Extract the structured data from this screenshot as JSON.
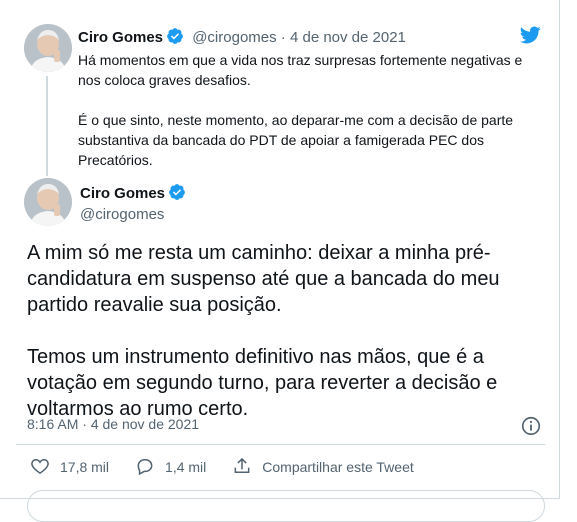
{
  "reply_tweet": {
    "author_name": "Ciro Gomes",
    "handle": "@cirogomes",
    "separator": "·",
    "date": "4 de nov de 2021",
    "paragraphs": [
      "Há momentos em que a vida nos traz surpresas fortemente negativas e nos coloca graves desafios.",
      "É o que sinto, neste momento, ao deparar-me com a decisão de parte substantiva da bancada do PDT de apoiar a famigerada PEC dos Precatórios."
    ]
  },
  "main_tweet": {
    "author_name": "Ciro Gomes",
    "handle": "@cirogomes",
    "paragraphs": [
      "A mim só me resta um caminho: deixar a minha pré-candidatura em suspenso até que a bancada do meu partido reavalie sua posição.",
      "Temos um instrumento definitivo nas mãos, que é a votação em segundo turno, para  reverter a decisão e voltarmos ao rumo certo."
    ],
    "time": "8:16 AM",
    "separator": "·",
    "date": "4 de nov de 2021"
  },
  "actions": {
    "likes": "17,8 mil",
    "replies": "1,4 mil",
    "share_label": "Compartilhar este Tweet"
  },
  "colors": {
    "twitter_blue": "#1d9bf0",
    "text": "#0f1419",
    "muted": "#536471",
    "border": "#cfd9de"
  },
  "icons": [
    "twitter-bird-icon",
    "verified-badge-icon",
    "info-icon",
    "heart-icon",
    "reply-bubble-icon",
    "share-icon"
  ]
}
